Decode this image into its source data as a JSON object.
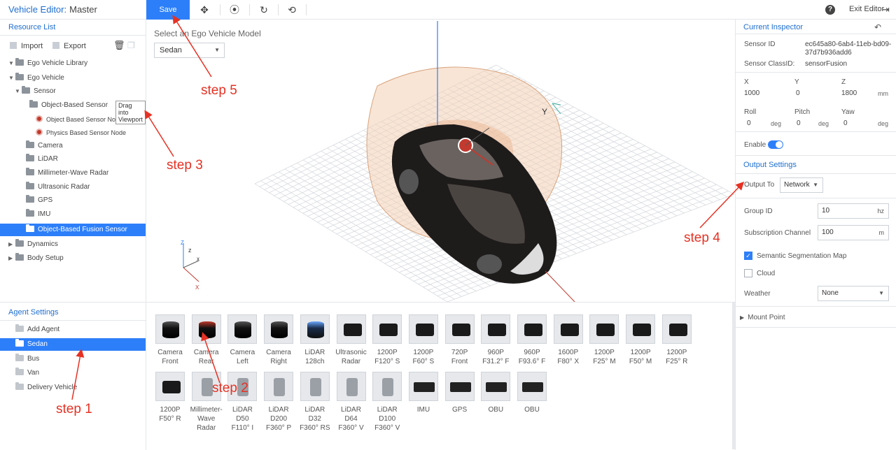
{
  "header": {
    "title": "Vehicle Editor:",
    "subtitle": "Master",
    "save_label": "Save",
    "exit_label": "Exit Editor"
  },
  "left_panel": {
    "resource_title": "Resource List",
    "import_label": "Import",
    "export_label": "Export",
    "tree": [
      {
        "label": "Ego Vehicle Library"
      },
      {
        "label": "Ego Vehicle"
      },
      {
        "label": "Sensor"
      },
      {
        "label": "Object-Based Sensor"
      },
      {
        "label": "Object Based Sensor Node"
      },
      {
        "label": "Physics Based Sensor Node"
      },
      {
        "label": "Camera"
      },
      {
        "label": "LiDAR"
      },
      {
        "label": "Millimeter-Wave Radar"
      },
      {
        "label": "Ultrasonic Radar"
      },
      {
        "label": "GPS"
      },
      {
        "label": "IMU"
      },
      {
        "label": "Object-Based Fusion Sensor"
      },
      {
        "label": "Dynamics"
      },
      {
        "label": "Body Setup"
      }
    ],
    "drag_tooltip": "Drag into Viewport",
    "agent_title": "Agent Settings",
    "agents": [
      {
        "label": "Add Agent"
      },
      {
        "label": "Sedan"
      },
      {
        "label": "Bus"
      },
      {
        "label": "Van"
      },
      {
        "label": "Delivery Vehicle"
      }
    ]
  },
  "viewport": {
    "model_label": "Select an Ego Vehicle Model",
    "model_value": "Sedan",
    "axis_z": "Z",
    "axis_y": "Y",
    "axis_x": "X",
    "gizmo_y": "Y",
    "gizmo_z": "z",
    "gizmo_x": "x"
  },
  "assets": [
    {
      "line1": "Camera",
      "line2": "Front",
      "kind": "cyl"
    },
    {
      "line1": "Camera",
      "line2": "Rear",
      "kind": "cyl-red"
    },
    {
      "line1": "Camera",
      "line2": "Left",
      "kind": "cyl"
    },
    {
      "line1": "Camera",
      "line2": "Right",
      "kind": "cyl"
    },
    {
      "line1": "LiDAR",
      "line2": "128ch",
      "kind": "cyl-blue"
    },
    {
      "line1": "Ultrasonic",
      "line2": "Radar",
      "kind": "cam"
    },
    {
      "line1": "1200P",
      "line2": "F120° S",
      "kind": "cam"
    },
    {
      "line1": "1200P",
      "line2": "F60° S",
      "kind": "cam"
    },
    {
      "line1": "720P",
      "line2": "Front",
      "kind": "cam"
    },
    {
      "line1": "960P",
      "line2": "F31.2° F",
      "kind": "cam"
    },
    {
      "line1": "960P",
      "line2": "F93.6° F",
      "kind": "cam"
    },
    {
      "line1": "1600P",
      "line2": "F80° X",
      "kind": "cam"
    },
    {
      "line1": "1200P",
      "line2": "F25° M",
      "kind": "cam"
    },
    {
      "line1": "1200P",
      "line2": "F50° M",
      "kind": "cam"
    },
    {
      "line1": "1200P",
      "line2": "F25° R",
      "kind": "cam"
    },
    {
      "line1": "1200P",
      "line2": "F50° R",
      "kind": "cam"
    },
    {
      "line1": "Millimeter-",
      "line2": "Wave Radar",
      "kind": "grey"
    },
    {
      "line1": "LiDAR D50",
      "line2": "F110° I",
      "kind": "grey"
    },
    {
      "line1": "LiDAR D200",
      "line2": "F360° P",
      "kind": "grey"
    },
    {
      "line1": "LiDAR D32",
      "line2": "F360° RS",
      "kind": "grey"
    },
    {
      "line1": "LiDAR D64",
      "line2": "F360° V",
      "kind": "grey"
    },
    {
      "line1": "LiDAR D100",
      "line2": "F360° V",
      "kind": "grey"
    },
    {
      "line1": "IMU",
      "line2": "",
      "kind": "box"
    },
    {
      "line1": "GPS",
      "line2": "",
      "kind": "box"
    },
    {
      "line1": "OBU",
      "line2": "",
      "kind": "box"
    },
    {
      "line1": "OBU",
      "line2": "",
      "kind": "box"
    }
  ],
  "inspector": {
    "title": "Current Inspector",
    "sensor_id_label": "Sensor ID",
    "sensor_id_line1": "ec645a80-6ab4-11eb-bd09-",
    "sensor_id_line2": "37d7b936add6",
    "class_id_label": "Sensor ClassID:",
    "class_id_value": "sensorFusion",
    "x_label": "X",
    "y_label": "Y",
    "z_label": "Z",
    "x_value": "1000",
    "y_value": "0",
    "z_value": "1800",
    "pos_unit": "mm",
    "roll_label": "Roll",
    "pitch_label": "Pitch",
    "yaw_label": "Yaw",
    "roll_value": "0",
    "pitch_value": "0",
    "yaw_value": "0",
    "deg_unit": "deg",
    "enable_label": "Enable",
    "output_title": "Output Settings",
    "output_to_label": "Output To",
    "output_to_value": "Network",
    "group_id_label": "Group ID",
    "group_id_value": "10",
    "group_id_unit": "hz",
    "sub_channel_label": "Subscription Channel",
    "sub_channel_value": "100",
    "sub_channel_unit": "m",
    "semantic_label": "Semantic Segmentation Map",
    "cloud_label": "Cloud",
    "weather_label": "Weather",
    "weather_value": "None",
    "mount_label": "Mount Point"
  },
  "annotations": {
    "step1": "step 1",
    "step2": "step 2",
    "step3": "step 3",
    "step4": "step 4",
    "step5": "step 5"
  },
  "colors": {
    "accent": "#2d7ff9",
    "title_blue": "#1f6fd0",
    "annotation_red": "#e53224"
  }
}
